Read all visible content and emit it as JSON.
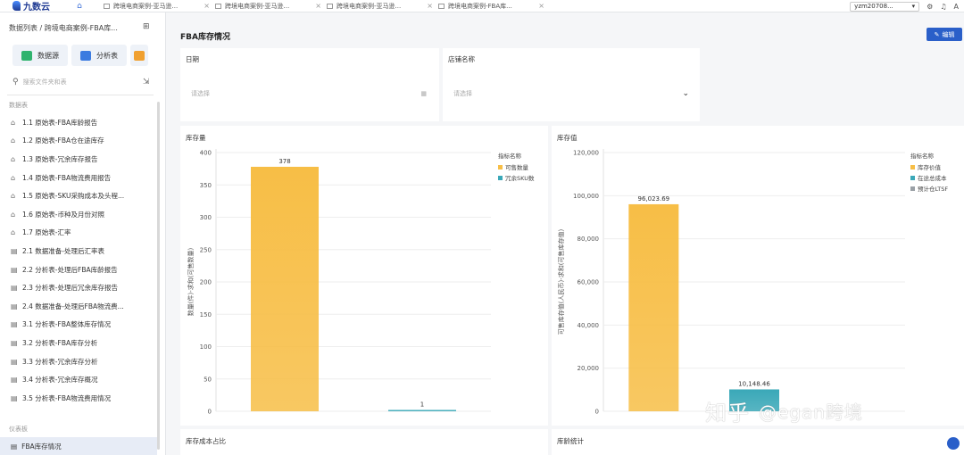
{
  "app": {
    "name": "九数云"
  },
  "tabs": [
    {
      "label": "跨境电商案例-亚马逊..."
    },
    {
      "label": "跨境电商案例-亚马逊..."
    },
    {
      "label": "跨境电商案例-亚马逊..."
    },
    {
      "label": "跨境电商案例-FBA库..."
    }
  ],
  "user": {
    "name": "yzm20708..."
  },
  "sidebar": {
    "breadcrumb": "数据列表 / 跨境电商案例-FBA库...",
    "btn_datasource": "数据源",
    "btn_analysis": "分析表",
    "search_placeholder": "搜索文件夹和表",
    "section_data": "数据表",
    "items": [
      {
        "label": "1.1 原始表-FBA库龄报告"
      },
      {
        "label": "1.2 原始表-FBA仓在途库存"
      },
      {
        "label": "1.3 原始表-冗余库存报告"
      },
      {
        "label": "1.4 原始表-FBA物流费用报告"
      },
      {
        "label": "1.5 原始表-SKU采购成本及头程..."
      },
      {
        "label": "1.6 原始表-币种及月份对照"
      },
      {
        "label": "1.7 原始表-汇率"
      },
      {
        "label": "2.1 数据准备-处理后汇率表"
      },
      {
        "label": "2.2 分析表-处理后FBA库龄报告"
      },
      {
        "label": "2.3 分析表-处理后冗余库存报告"
      },
      {
        "label": "2.4 数据准备-处理后FBA物流费..."
      },
      {
        "label": "3.1 分析表-FBA整体库存情况"
      },
      {
        "label": "3.2 分析表-FBA库存分析"
      },
      {
        "label": "3.3 分析表-冗余库存分析"
      },
      {
        "label": "3.4 分析表-冗余库存概况"
      },
      {
        "label": "3.5 分析表-FBA物流费用情况"
      }
    ],
    "section_dashboard": "仪表板",
    "active_item": "FBA库存情况"
  },
  "main": {
    "title": "FBA库存情况",
    "edit_label": "编辑",
    "filter_date_label": "日期",
    "filter_date_placeholder": "请选择",
    "filter_shop_label": "店铺名称",
    "filter_shop_placeholder": "请选择",
    "panel_bottom_left": "库存成本占比",
    "panel_bottom_right": "库龄统计"
  },
  "watermark": {
    "text1": "知乎",
    "text2": "@egan跨境"
  },
  "colors": {
    "accent": "#2a5fc9",
    "bar_orange": "#f7be46",
    "bar_teal": "#3aa8b8"
  },
  "chart_data": [
    {
      "type": "bar",
      "title": "库存量",
      "ylabel": "数量(件)-求和(可售数量)",
      "ylim": [
        0,
        400
      ],
      "yticks": [
        0,
        50,
        100,
        150,
        200,
        250,
        300,
        350,
        400
      ],
      "legend_title": "指标名称",
      "legend_position": "top-right",
      "series": [
        {
          "name": "可售数量",
          "color": "#f7be46",
          "value": 378,
          "label": "378"
        },
        {
          "name": "冗余SKU数",
          "color": "#3aa8b8",
          "value": 1,
          "label": "1"
        }
      ]
    },
    {
      "type": "bar",
      "title": "库存值",
      "ylabel": "可售库存值(人民币)-求和(可售库存值)",
      "ylim": [
        0,
        120000
      ],
      "yticks": [
        0,
        20000,
        40000,
        60000,
        80000,
        100000,
        120000
      ],
      "ytick_labels": [
        "0",
        "20,000",
        "40,000",
        "60,000",
        "80,000",
        "100,000",
        "120,000"
      ],
      "legend_title": "指标名称",
      "legend_position": "top-right",
      "series": [
        {
          "name": "库存价值",
          "color": "#f7be46",
          "value": 96023.69,
          "label": "96,023.69"
        },
        {
          "name": "在途总成本",
          "color": "#3aa8b8",
          "value": 10148.46,
          "label": "10,148.46"
        },
        {
          "name": "预计仓LTSF",
          "color": "#9aa0a6",
          "value": 0,
          "label": ""
        }
      ]
    }
  ]
}
